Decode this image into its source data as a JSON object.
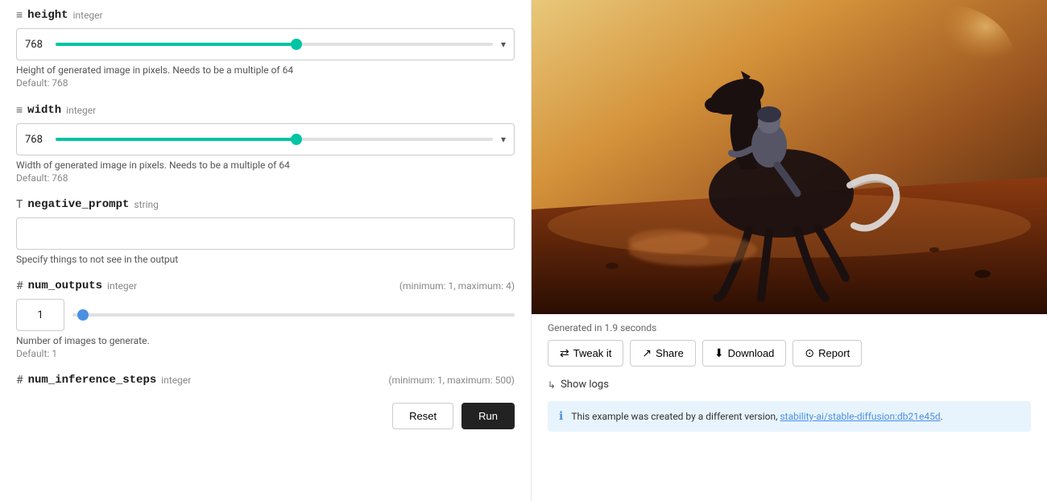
{
  "left": {
    "height_field": {
      "icon": "≡",
      "name": "height",
      "type": "integer",
      "value": "768",
      "fill_percent": 55,
      "description": "Height of generated image in pixels. Needs to be a multiple of 64",
      "default": "Default: 768"
    },
    "width_field": {
      "icon": "≡",
      "name": "width",
      "type": "integer",
      "value": "768",
      "fill_percent": 55,
      "description": "Width of generated image in pixels. Needs to be a multiple of 64",
      "default": "Default: 768"
    },
    "negative_prompt_field": {
      "icon": "T",
      "name": "negative_prompt",
      "type": "string",
      "value": "",
      "placeholder": "",
      "description": "Specify things to not see in the output"
    },
    "num_outputs_field": {
      "icon": "#",
      "name": "num_outputs",
      "type": "integer",
      "range": "(minimum: 1, maximum: 4)",
      "value": "1",
      "description": "Number of images to generate.",
      "default": "Default: 1"
    },
    "num_inference_steps_field": {
      "icon": "#",
      "name": "num_inference_steps",
      "type": "integer",
      "range": "(minimum: 1, maximum: 500)"
    },
    "buttons": {
      "reset": "Reset",
      "run": "Run"
    }
  },
  "right": {
    "generated_info": "Generated in 1.9 seconds",
    "action_buttons": [
      {
        "id": "tweak",
        "icon": "⇄",
        "label": "Tweak it"
      },
      {
        "id": "share",
        "icon": "↗",
        "label": "Share"
      },
      {
        "id": "download",
        "icon": "⬇",
        "label": "Download"
      },
      {
        "id": "report",
        "icon": "⏱",
        "label": "Report"
      }
    ],
    "show_logs_label": "Show logs",
    "info_message_prefix": "This example was created by a different version, ",
    "info_link_text": "stability-ai/stable-diffusion:db21e45d",
    "info_link_suffix": "."
  }
}
